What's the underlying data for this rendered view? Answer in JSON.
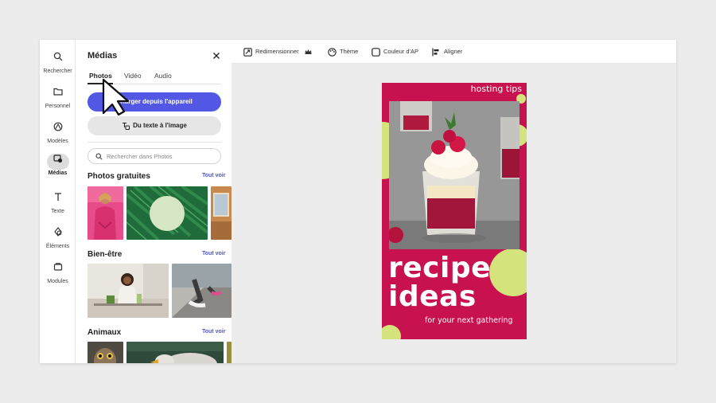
{
  "rail": {
    "items": [
      {
        "label": "Rechercher",
        "icon": "search-icon"
      },
      {
        "label": "Personnel",
        "icon": "folder-icon"
      },
      {
        "label": "Modèles",
        "icon": "templates-icon"
      },
      {
        "label": "Médias",
        "icon": "media-icon",
        "active": true
      },
      {
        "label": "Texte",
        "icon": "text-icon"
      },
      {
        "label": "Éléments",
        "icon": "shapes-icon"
      },
      {
        "label": "Modules",
        "icon": "modules-icon"
      }
    ]
  },
  "panel": {
    "title": "Médias",
    "tabs": [
      "Photos",
      "Vidéo",
      "Audio"
    ],
    "active_tab": "Photos",
    "upload_label": "Charger depuis l'appareil",
    "text_to_image_label": "Du texte à l'image",
    "search_placeholder": "Rechercher dans Photos",
    "sections": [
      {
        "title": "Photos gratuites",
        "see_all": "Tout voir"
      },
      {
        "title": "Bien-être",
        "see_all": "Tout voir"
      },
      {
        "title": "Animaux",
        "see_all": "Tout voir"
      }
    ]
  },
  "toolbar": {
    "items": [
      "Redimensionner",
      "Thème",
      "Couleur d'AP",
      "Aligner"
    ]
  },
  "poster": {
    "tag": "hosting tips",
    "headline_line1": "recipe",
    "headline_line2": "ideas",
    "subline": "for your next gathering"
  },
  "colors": {
    "accent": "#5258e4",
    "poster_bg": "#c7124f",
    "poster_lime": "#d4e37c",
    "link": "#4b55d8"
  }
}
